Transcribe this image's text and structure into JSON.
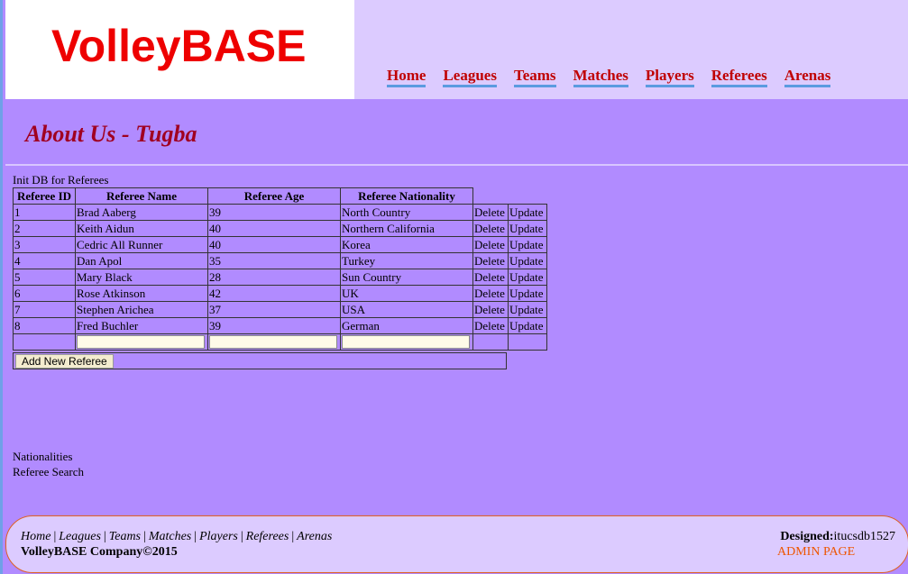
{
  "header": {
    "logo": "VolleyBASE",
    "nav": [
      "Home",
      "Leagues",
      "Teams",
      "Matches",
      "Players",
      "Referees",
      "Arenas"
    ]
  },
  "page_title": "About Us - Tugba",
  "init_link": "Init DB for Referees",
  "table": {
    "headers": [
      "Referee ID",
      "Referee Name",
      "Referee Age",
      "Referee Nationality"
    ],
    "rows": [
      [
        "1",
        "Brad Aaberg",
        "39",
        "North Country"
      ],
      [
        "2",
        "Keith Aidun",
        "40",
        "Northern California"
      ],
      [
        "3",
        "Cedric All Runner",
        "40",
        "Korea"
      ],
      [
        "4",
        "Dan Apol",
        "35",
        "Turkey"
      ],
      [
        "5",
        "Mary Black",
        "28",
        "Sun Country"
      ],
      [
        "6",
        "Rose Atkinson",
        "42",
        "UK"
      ],
      [
        "7",
        "Stephen Arichea",
        "37",
        "USA"
      ],
      [
        "8",
        "Fred Buchler",
        "39",
        "German"
      ]
    ],
    "delete_label": "Delete",
    "update_label": "Update",
    "add_button": "Add New Referee"
  },
  "links": {
    "nationalities": "Nationalities",
    "search": "Referee Search"
  },
  "footer": {
    "links": [
      "Home",
      "Leagues",
      "Teams",
      "Matches",
      "Players",
      "Referees",
      "Arenas"
    ],
    "separator": "|",
    "copyright": "VolleyBASE Company©2015",
    "designed_label": "Designed:",
    "designed_value": "itucsdb1527",
    "admin": "ADMIN PAGE"
  },
  "colors": {
    "background": "#b18bff",
    "header_bg": "#dccbff",
    "logo": "#ee0000",
    "nav": "#c00000",
    "title": "#a00020",
    "admin_link": "#ee5500"
  }
}
